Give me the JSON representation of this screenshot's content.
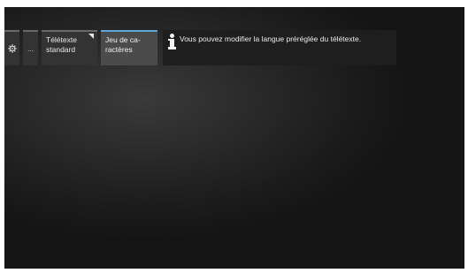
{
  "menu": {
    "settings_icon": "gear-icon",
    "more_label": "...",
    "teletext_tile": {
      "line1": "Télétexte",
      "line2": "standard"
    },
    "charset_tile": {
      "line1": "Jeu de ca-",
      "line2": "ractères"
    }
  },
  "info": {
    "icon": "info-icon",
    "text": "Vous pouvez modifier la langue préréglée du télétexte."
  },
  "colors": {
    "accent": "#5fa6d6",
    "tile_bg": "#333333",
    "active_tile_bg": "#4b4b4b",
    "screen_bg": "#1c1c1c"
  }
}
